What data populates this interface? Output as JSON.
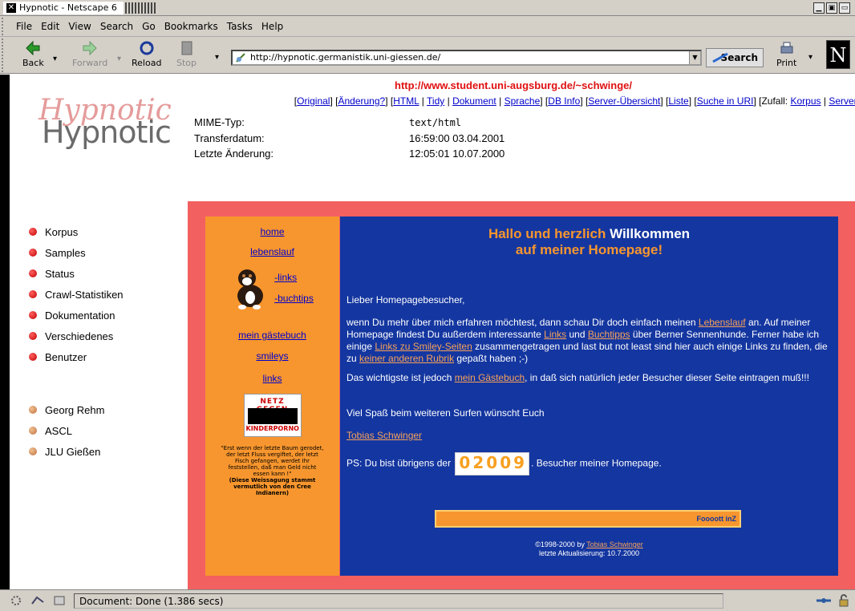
{
  "window": {
    "title": "Hypnotic - Netscape 6"
  },
  "menu": [
    "File",
    "Edit",
    "View",
    "Search",
    "Go",
    "Bookmarks",
    "Tasks",
    "Help"
  ],
  "toolbar": {
    "back": "Back",
    "forward": "Forward",
    "reload": "Reload",
    "stop": "Stop",
    "url": "http://hypnotic.germanistik.uni-giessen.de/",
    "search": "Search",
    "print": "Print"
  },
  "hypnotic": {
    "logo_text": "Hypnotic",
    "logo_overlay": "Hypnotic",
    "source_url": "http://www.student.uni-augsburg.de/~schwinge/",
    "links": [
      "Original",
      "Änderung?",
      "HTML",
      "Tidy",
      "Dokument",
      "Sprache",
      "DB Info",
      "Server-Übersicht",
      "Liste",
      "Suche in URI"
    ],
    "zufall_label": "[Zufall:",
    "zufall_links": [
      "Korpus",
      "Server"
    ],
    "meta": [
      {
        "label": "MIME-Typ:",
        "value": "text/html"
      },
      {
        "label": "Transferdatum:",
        "value": "16:59:00 03.04.2001"
      },
      {
        "label": "Letzte Änderung:",
        "value": "12:05:01 10.07.2000"
      }
    ],
    "sidebar_main": [
      "Korpus",
      "Samples",
      "Status",
      "Crawl-Statistiken",
      "Dokumentation",
      "Verschiedenes",
      "Benutzer"
    ],
    "sidebar_people": [
      "Georg Rehm",
      "ASCL",
      "JLU Gießen"
    ]
  },
  "page": {
    "left_nav": {
      "home": "home",
      "lebenslauf": "lebenslauf",
      "links_sub": "-links",
      "buchtips": "-buchtips",
      "gaestebuch": "mein gästebuch",
      "smileys": "smileys",
      "links": "links",
      "banner_line1": "NETZ GEGEN",
      "banner_line2": "KINDERPORNO",
      "quote": "\"Erst wenn der letzte Baum gerodet, der letzt Fluss vergiftet, der letzt Fisch gefangen, werdet Ihr feststellen, daß man Geld nicht essen kann !\"",
      "quote_note": "(Diese Weissagung stammt vermutlich von den Cree Indianern)"
    },
    "hero_line1_a": "Hallo und herzlich ",
    "hero_line1_b": "Willkommen",
    "hero_line2": "auf meiner Homepage!",
    "greeting": "Lieber Homepagebesucher,",
    "p1_a": "wenn Du mehr über mich erfahren möchtest, dann schau Dir doch einfach meinen ",
    "p1_link1": "Lebenslauf",
    "p1_b": " an. Auf meiner Homepage findest Du außerdem interessante ",
    "p1_link2": "Links",
    "p1_c": " und ",
    "p1_link3": "Buchtipps",
    "p1_d": " über Berner Sennenhunde. Ferner habe ich einige ",
    "p1_link4": "Links zu Smiley-Seiten",
    "p1_e": " zusammengetragen und last but not least sind hier auch einige Links zu finden, die zu ",
    "p1_link5": "keiner anderen Rubrik",
    "p1_f": " gepaßt haben ;-)",
    "p2_a": "Das wichtigste ist jedoch ",
    "p2_link": "mein Gästebuch",
    "p2_b": ", in daß sich natürlich jeder Besucher dieser Seite eintragen muß!!!",
    "p3": "Viel Spaß beim weiteren Surfen wünscht Euch",
    "author": "Tobias Schwinger",
    "ps_a": "PS: Du bist übrigens der",
    "counter_digits": [
      "0",
      "2",
      "0",
      "0",
      "9"
    ],
    "ps_b": ". Besucher meiner Homepage.",
    "bar_label": "Foooott inZ",
    "copyright_a": "©1998-2000 by ",
    "copyright_link": "Tobias Schwinger",
    "last_update": "letzte Aktualisierung: 10.7.2000"
  },
  "status": {
    "text": "Document: Done (1.386 secs)"
  }
}
